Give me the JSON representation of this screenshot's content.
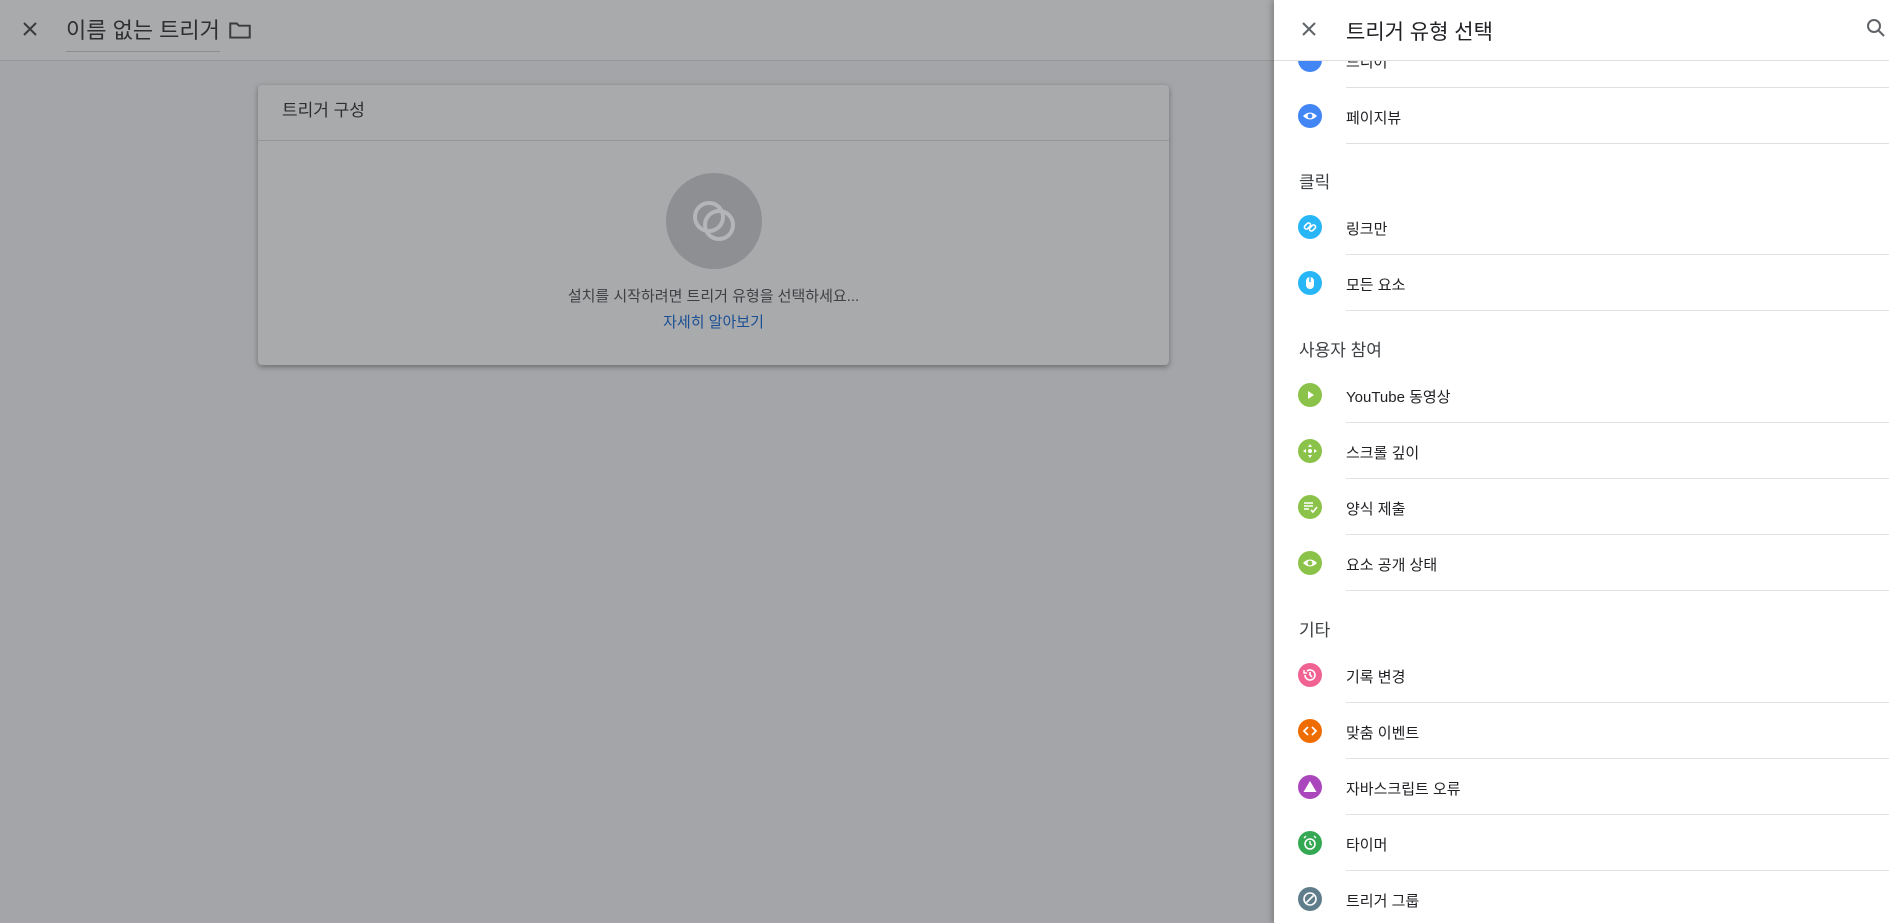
{
  "editor": {
    "trigger_name": "이름 없는 트리거",
    "card_title": "트리거 구성",
    "card_hint": "설치를 시작하려면 트리거 유형을 선택하세요...",
    "card_link": "자세히 알아보기"
  },
  "panel": {
    "title": "트리거 유형 선택",
    "partial_item": "드디어",
    "items": [
      {
        "label": "페이지뷰",
        "icon": "eye-icon",
        "color": "#4285f4"
      },
      {
        "label": "링크만",
        "icon": "link-icon",
        "color": "#29b6f6"
      },
      {
        "label": "모든 요소",
        "icon": "mouse-icon",
        "color": "#29b6f6"
      },
      {
        "label": "YouTube 동영상",
        "icon": "play-icon",
        "color": "#8bc34a"
      },
      {
        "label": "스크롤 깊이",
        "icon": "scroll-icon",
        "color": "#8bc34a"
      },
      {
        "label": "양식 제출",
        "icon": "form-icon",
        "color": "#8bc34a"
      },
      {
        "label": "요소 공개 상태",
        "icon": "eye-icon",
        "color": "#8bc34a"
      },
      {
        "label": "기록 변경",
        "icon": "history-icon",
        "color": "#f06292"
      },
      {
        "label": "맞춤 이벤트",
        "icon": "code-icon",
        "color": "#ef6c00"
      },
      {
        "label": "자바스크립트 오류",
        "icon": "warning-icon",
        "color": "#ab47bc"
      },
      {
        "label": "타이머",
        "icon": "alarm-icon",
        "color": "#34a853"
      },
      {
        "label": "트리거 그룹",
        "icon": "group-icon",
        "color": "#607d8b"
      }
    ],
    "sections": {
      "click": "클릭",
      "engagement": "사용자 참여",
      "other": "기타"
    }
  }
}
